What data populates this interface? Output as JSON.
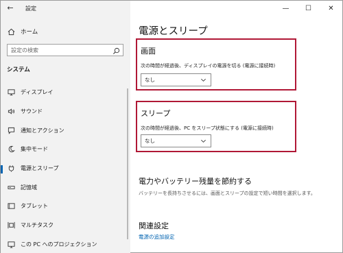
{
  "window": {
    "app_title": "設定",
    "back_icon": "back-arrow-icon",
    "minimize_label": "—",
    "maximize_label": "☐",
    "close_label": "✕"
  },
  "sidebar": {
    "home_label": "ホーム",
    "search_placeholder": "設定の検索",
    "section_label": "システム",
    "items": [
      {
        "label": "ディスプレイ",
        "icon": "monitor-icon",
        "active": false
      },
      {
        "label": "サウンド",
        "icon": "speaker-icon",
        "active": false
      },
      {
        "label": "通知とアクション",
        "icon": "notification-icon",
        "active": false
      },
      {
        "label": "集中モード",
        "icon": "moon-icon",
        "active": false
      },
      {
        "label": "電源とスリープ",
        "icon": "power-icon",
        "active": true
      },
      {
        "label": "記憶域",
        "icon": "storage-icon",
        "active": false
      },
      {
        "label": "タブレット",
        "icon": "tablet-icon",
        "active": false
      },
      {
        "label": "マルチタスク",
        "icon": "multitask-icon",
        "active": false
      },
      {
        "label": "この PC へのプロジェクション",
        "icon": "projection-icon",
        "active": false
      }
    ]
  },
  "main": {
    "title": "電源とスリープ",
    "screen": {
      "heading": "画面",
      "description": "次の時間が経過後、ディスプレイの電源を切る (電源に接続時)",
      "value": "なし"
    },
    "sleep": {
      "heading": "スリープ",
      "description": "次の時間が経過後、PC をスリープ状態にする (電源に接続時)",
      "value": "なし"
    },
    "save_power": {
      "title": "電力やバッテリー残量を節約する",
      "description": "バッテリーを長持ちさせるには、画面とスリープの設定で短い時間を選択します。"
    },
    "related": {
      "title": "関連設定",
      "link": "電源の追加設定"
    }
  },
  "colors": {
    "accent": "#0063b1",
    "highlight_border": "#b01735",
    "sidebar_bg": "#f2f2f2"
  }
}
